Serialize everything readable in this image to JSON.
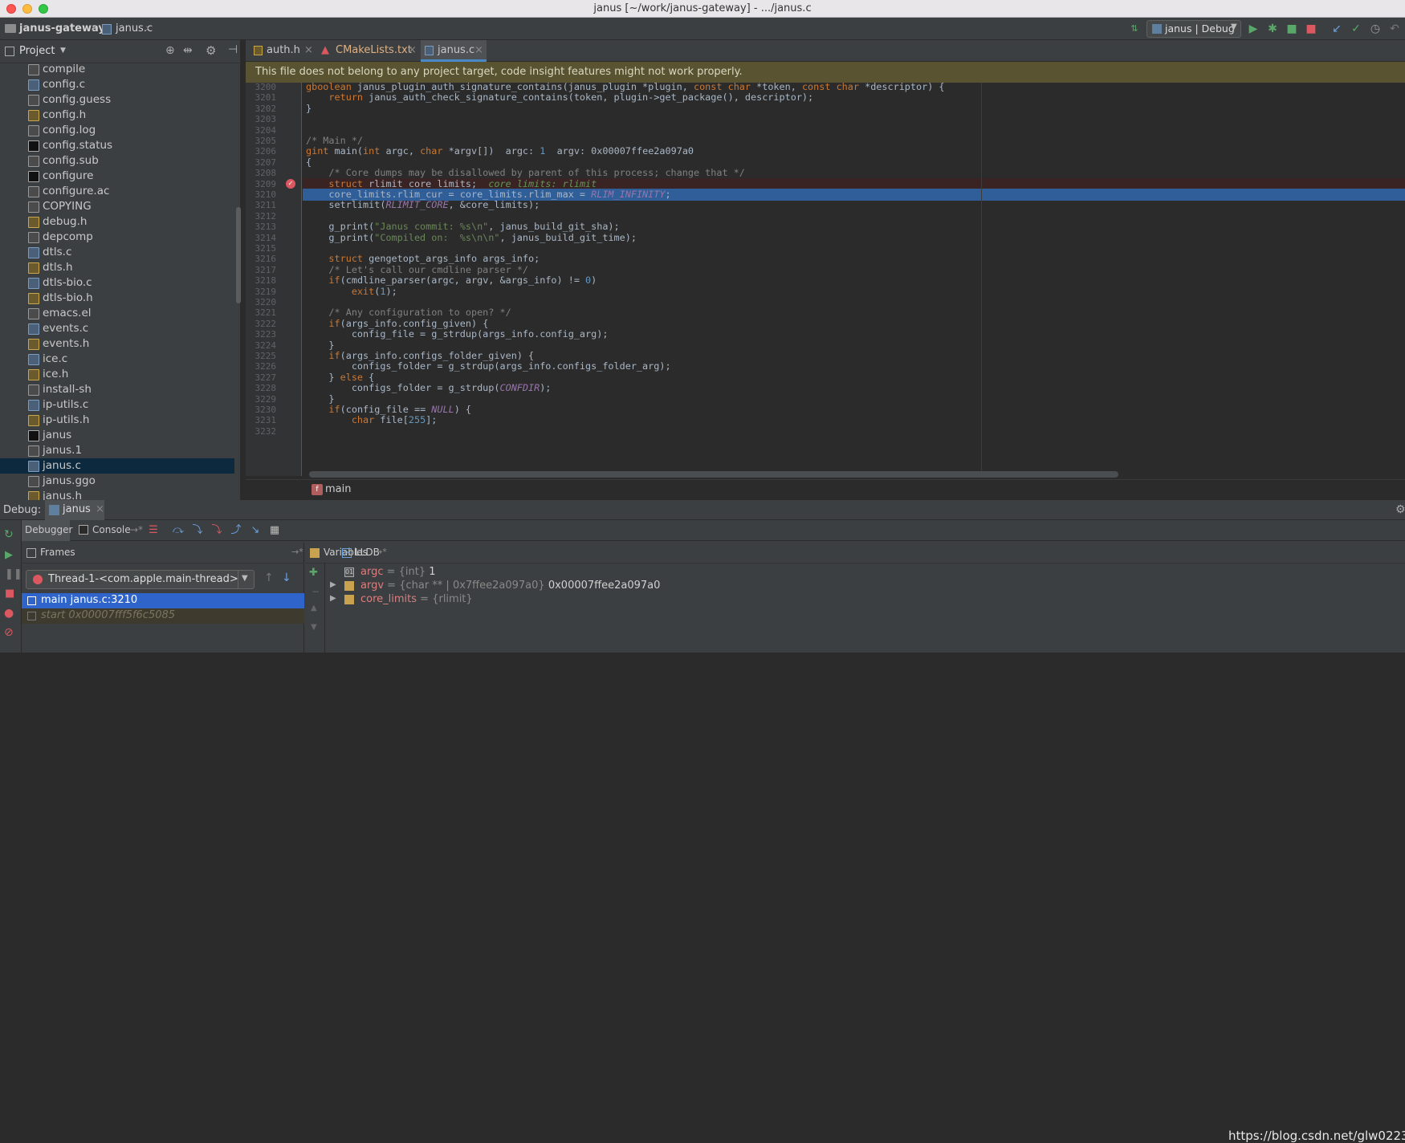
{
  "window": {
    "title": "janus [~/work/janus-gateway] - .../janus.c"
  },
  "navbar": {
    "project": "janus-gateway",
    "file": "janus.c",
    "run_config": "janus | Debug"
  },
  "project_panel": {
    "title": "Project",
    "files": [
      {
        "name": "compile",
        "type": "txt"
      },
      {
        "name": "config.c",
        "type": "c"
      },
      {
        "name": "config.guess",
        "type": "txt"
      },
      {
        "name": "config.h",
        "type": "h"
      },
      {
        "name": "config.log",
        "type": "txt"
      },
      {
        "name": "config.status",
        "type": "term"
      },
      {
        "name": "config.sub",
        "type": "txt"
      },
      {
        "name": "configure",
        "type": "term"
      },
      {
        "name": "configure.ac",
        "type": "txt"
      },
      {
        "name": "COPYING",
        "type": "txt"
      },
      {
        "name": "debug.h",
        "type": "h"
      },
      {
        "name": "depcomp",
        "type": "txt"
      },
      {
        "name": "dtls.c",
        "type": "c"
      },
      {
        "name": "dtls.h",
        "type": "h"
      },
      {
        "name": "dtls-bio.c",
        "type": "c"
      },
      {
        "name": "dtls-bio.h",
        "type": "h"
      },
      {
        "name": "emacs.el",
        "type": "txt"
      },
      {
        "name": "events.c",
        "type": "c"
      },
      {
        "name": "events.h",
        "type": "h"
      },
      {
        "name": "ice.c",
        "type": "c"
      },
      {
        "name": "ice.h",
        "type": "h"
      },
      {
        "name": "install-sh",
        "type": "txt"
      },
      {
        "name": "ip-utils.c",
        "type": "c"
      },
      {
        "name": "ip-utils.h",
        "type": "h"
      },
      {
        "name": "janus",
        "type": "term"
      },
      {
        "name": "janus.1",
        "type": "txt"
      },
      {
        "name": "janus.c",
        "type": "c",
        "selected": true
      },
      {
        "name": "janus.ggo",
        "type": "txt"
      },
      {
        "name": "janus.h",
        "type": "h"
      }
    ]
  },
  "editor": {
    "tabs": [
      {
        "label": "auth.h",
        "active": false
      },
      {
        "label": "CMakeLists.txt",
        "active": false
      },
      {
        "label": "janus.c",
        "active": true
      }
    ],
    "banner": "This file does not belong to any project target, code insight features might not work properly.",
    "lines": [
      {
        "n": "3200",
        "text": "gboolean janus_plugin_auth_signature_contains(janus_plugin *plugin, const char *token, const char *descriptor) {"
      },
      {
        "n": "3201",
        "text": "    return janus_auth_check_signature_contains(token, plugin->get_package(), descriptor);"
      },
      {
        "n": "3202",
        "text": "}"
      },
      {
        "n": "3203",
        "text": ""
      },
      {
        "n": "3204",
        "text": ""
      },
      {
        "n": "3205",
        "text": "/* Main */"
      },
      {
        "n": "3206",
        "text": "gint main(int argc, char *argv[])  argc: 1  argv: 0x00007ffee2a097a0"
      },
      {
        "n": "3207",
        "text": "{"
      },
      {
        "n": "3208",
        "text": "    /* Core dumps may be disallowed by parent of this process; change that */"
      },
      {
        "n": "3209",
        "text": "    struct rlimit core_limits;  core_limits: rlimit",
        "breakpoint": true
      },
      {
        "n": "3210",
        "text": "    core_limits.rlim_cur = core_limits.rlim_max = RLIM_INFINITY;",
        "current": true
      },
      {
        "n": "3211",
        "text": "    setrlimit(RLIMIT_CORE, &core_limits);"
      },
      {
        "n": "3212",
        "text": ""
      },
      {
        "n": "3213",
        "text": "    g_print(\"Janus commit: %s\\n\", janus_build_git_sha);"
      },
      {
        "n": "3214",
        "text": "    g_print(\"Compiled on:  %s\\n\\n\", janus_build_git_time);"
      },
      {
        "n": "3215",
        "text": ""
      },
      {
        "n": "3216",
        "text": "    struct gengetopt_args_info args_info;"
      },
      {
        "n": "3217",
        "text": "    /* Let's call our cmdline parser */"
      },
      {
        "n": "3218",
        "text": "    if(cmdline_parser(argc, argv, &args_info) != 0)"
      },
      {
        "n": "3219",
        "text": "        exit(1);"
      },
      {
        "n": "3220",
        "text": ""
      },
      {
        "n": "3221",
        "text": "    /* Any configuration to open? */"
      },
      {
        "n": "3222",
        "text": "    if(args_info.config_given) {"
      },
      {
        "n": "3223",
        "text": "        config_file = g_strdup(args_info.config_arg);"
      },
      {
        "n": "3224",
        "text": "    }"
      },
      {
        "n": "3225",
        "text": "    if(args_info.configs_folder_given) {"
      },
      {
        "n": "3226",
        "text": "        configs_folder = g_strdup(args_info.configs_folder_arg);"
      },
      {
        "n": "3227",
        "text": "    } else {"
      },
      {
        "n": "3228",
        "text": "        configs_folder = g_strdup(CONFDIR);"
      },
      {
        "n": "3229",
        "text": "    }"
      },
      {
        "n": "3230",
        "text": "    if(config_file == NULL) {"
      },
      {
        "n": "3231",
        "text": "        char file[255];"
      },
      {
        "n": "3232",
        "text": ""
      }
    ],
    "breadcrumb": "main"
  },
  "debug": {
    "label": "Debug:",
    "session": "janus",
    "tabs": {
      "debugger": "Debugger",
      "console": "Console"
    },
    "frames": {
      "title": "Frames",
      "thread": "Thread-1-<com.apple.main-thread>",
      "items": [
        {
          "text": "main janus.c:3210",
          "selected": true
        },
        {
          "text": "start 0x00007fff5f6c5085",
          "selected": false
        }
      ]
    },
    "variables": {
      "title": "Variables",
      "lldb": "LLDB",
      "items": [
        {
          "name": "argc",
          "type": "= {int}",
          "value": "1",
          "expandable": false
        },
        {
          "name": "argv",
          "type": "= {char ** | 0x7ffee2a097a0}",
          "value": "0x00007ffee2a097a0",
          "expandable": true
        },
        {
          "name": "core_limits",
          "type": "= {rlimit}",
          "value": "",
          "expandable": true
        }
      ]
    }
  },
  "watermark": "https://blog.csdn.net/glw0223",
  "colors": {
    "accent": "#4a88c7",
    "current_line": "#2f5e99",
    "banner": "#5a5331",
    "run_green": "#59a869",
    "stop_red": "#db5860"
  }
}
